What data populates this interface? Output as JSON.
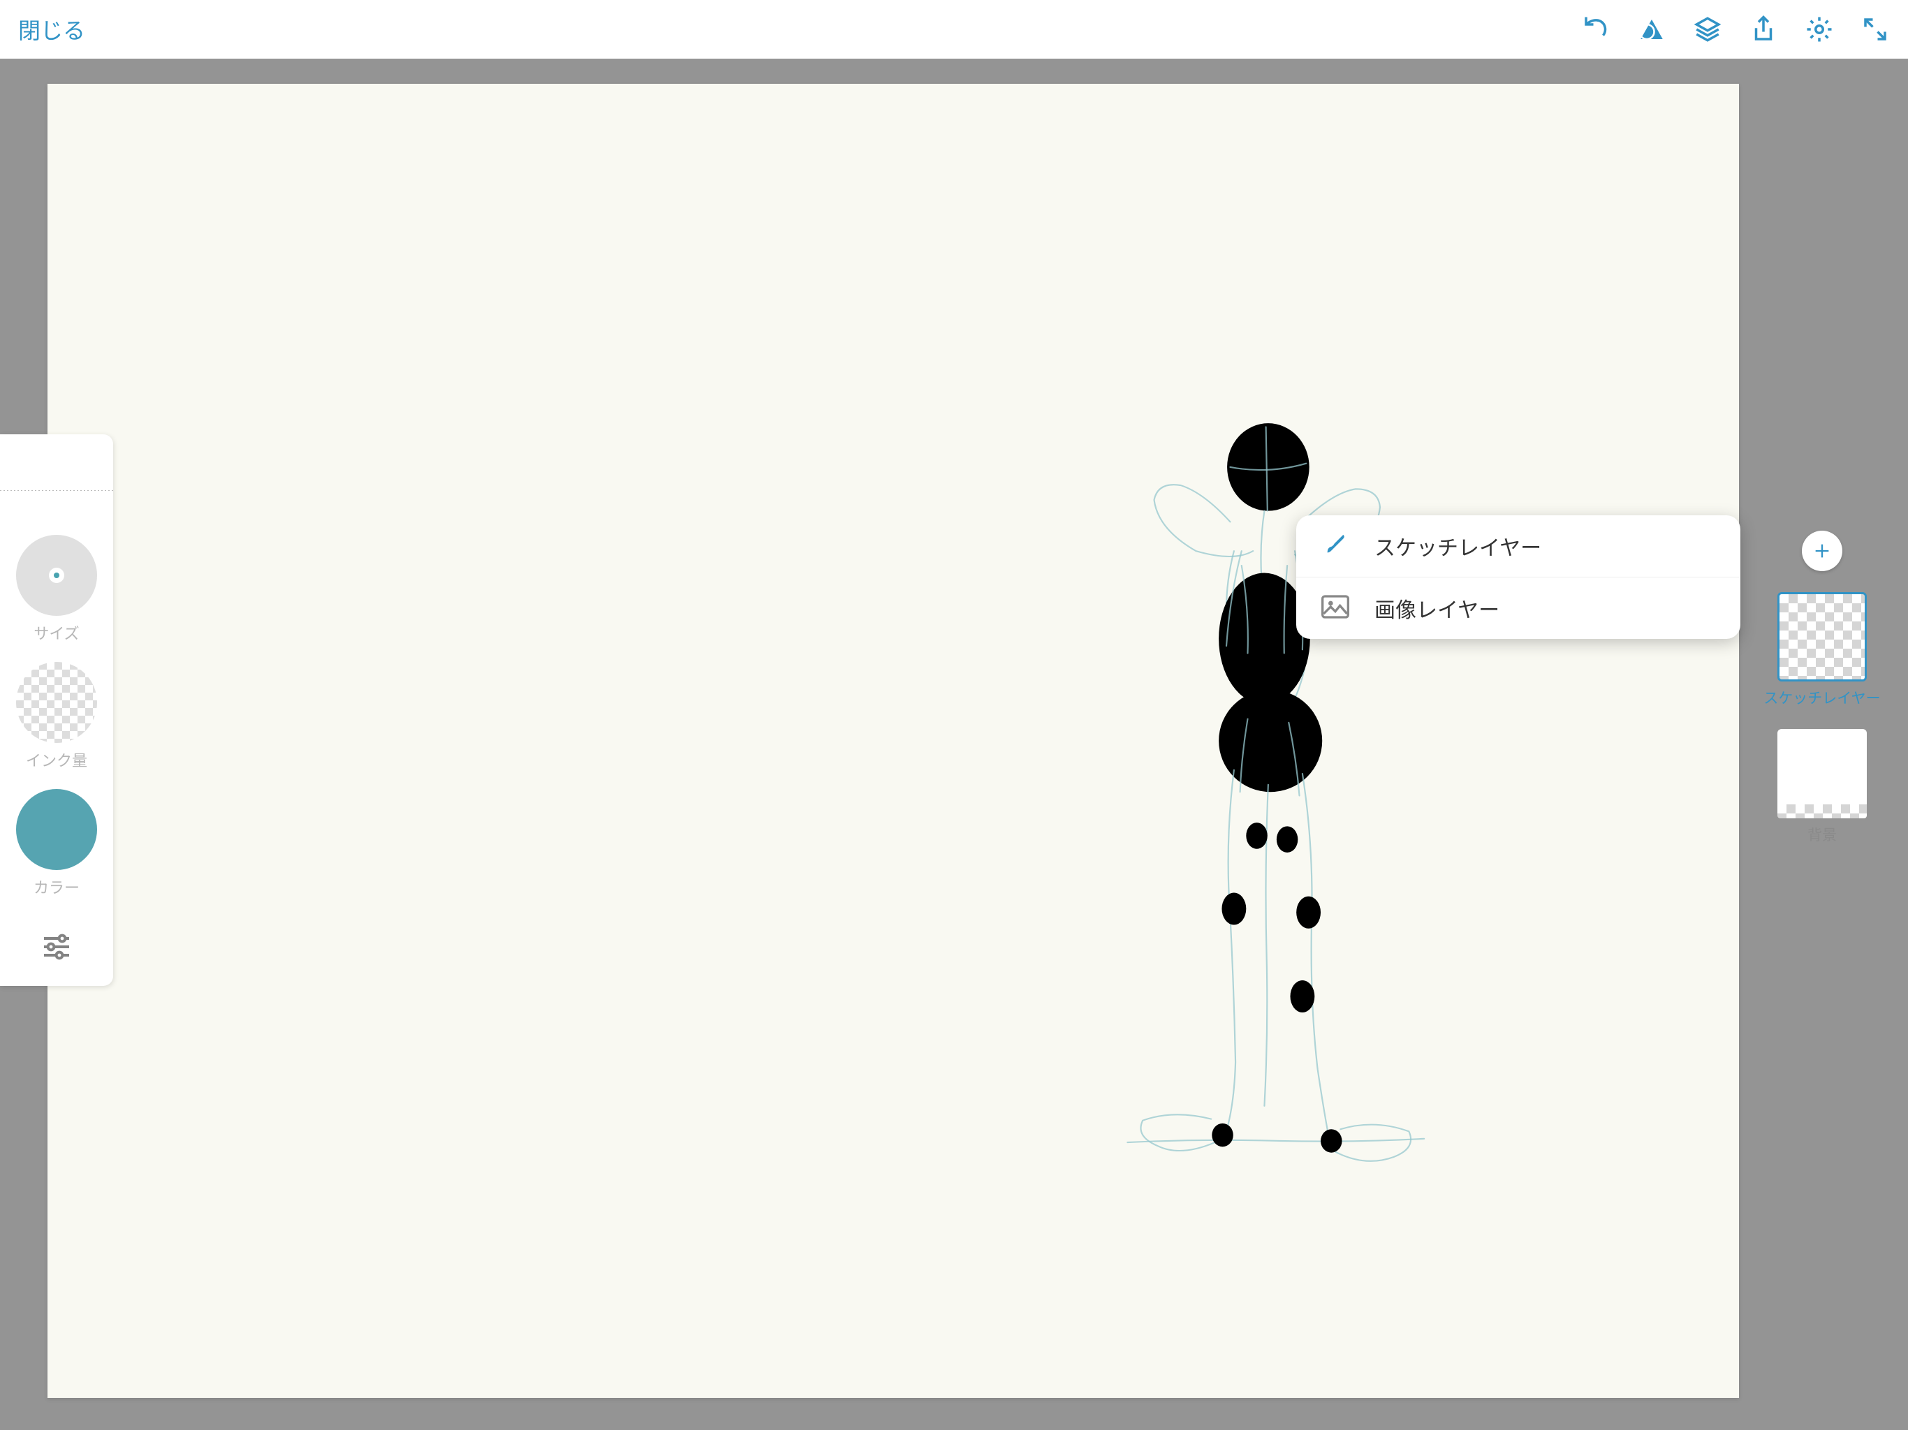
{
  "topbar": {
    "close": "閉じる"
  },
  "tools": {
    "size_label": "サイズ",
    "ink_label": "インク量",
    "color_label": "カラー",
    "color_value": "#56a4b1"
  },
  "popover": {
    "items": [
      {
        "label": "スケッチレイヤー"
      },
      {
        "label": "画像レイヤー"
      }
    ]
  },
  "layers": {
    "items": [
      {
        "label": "スケッチレイヤー",
        "active": true
      },
      {
        "label": "背景",
        "active": false
      }
    ]
  },
  "accent": "#3193c6"
}
